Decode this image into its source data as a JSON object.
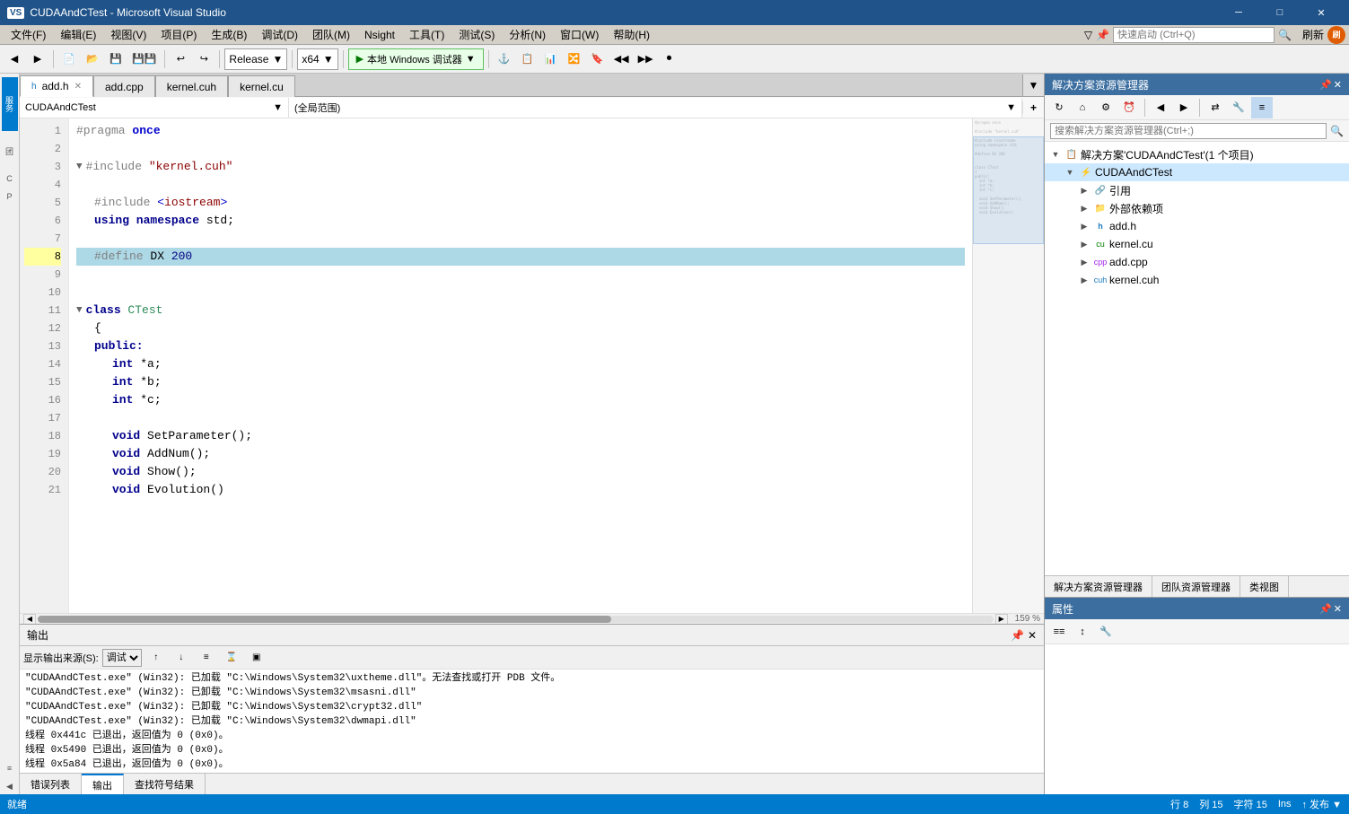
{
  "titleBar": {
    "appName": "CUDAAndCTest - Microsoft Visual Studio",
    "logo": "VS",
    "controls": {
      "minimize": "─",
      "maximize": "□",
      "close": "✕"
    }
  },
  "menuBar": {
    "items": [
      "文件(F)",
      "编辑(E)",
      "视图(V)",
      "项目(P)",
      "生成(B)",
      "调试(D)",
      "团队(M)",
      "Nsight",
      "工具(T)",
      "测试(S)",
      "分析(N)",
      "窗口(W)",
      "帮助(H)"
    ]
  },
  "toolbar": {
    "configuration": "Release",
    "platform": "x64",
    "debugBtn": "▶ 本地 Windows 调试器 ▼",
    "quickLaunch": {
      "placeholder": "快速启动 (Ctrl+Q)"
    }
  },
  "userInfo": {
    "name": "刷新"
  },
  "tabs": [
    {
      "name": "add.h",
      "active": true,
      "modified": false
    },
    {
      "name": "add.cpp",
      "active": false
    },
    {
      "name": "kernel.cuh",
      "active": false
    },
    {
      "name": "kernel.cu",
      "active": false
    }
  ],
  "codeBar": {
    "className": "CUDAAndCTest",
    "memberName": "(全局范围)"
  },
  "code": {
    "lines": [
      {
        "num": 1,
        "indicator": "green",
        "text": "#pragma once",
        "type": "pragma"
      },
      {
        "num": 2,
        "indicator": "green",
        "text": "",
        "type": "empty"
      },
      {
        "num": 3,
        "indicator": "none",
        "text": "▼#include \"kernel.cuh\"",
        "type": "include"
      },
      {
        "num": 4,
        "indicator": "green",
        "text": "",
        "type": "empty"
      },
      {
        "num": 5,
        "indicator": "green",
        "text": "\t#include <iostream>",
        "type": "include2"
      },
      {
        "num": 6,
        "indicator": "green",
        "text": "\tusing namespace std;",
        "type": "using"
      },
      {
        "num": 7,
        "indicator": "green",
        "text": "",
        "type": "empty"
      },
      {
        "num": 8,
        "indicator": "green",
        "text": "\t#define DX 200",
        "type": "define"
      },
      {
        "num": 9,
        "indicator": "green",
        "text": "",
        "type": "empty"
      },
      {
        "num": 10,
        "indicator": "green",
        "text": "",
        "type": "empty"
      },
      {
        "num": 11,
        "indicator": "none",
        "text": "▼class CTest",
        "type": "class"
      },
      {
        "num": 12,
        "indicator": "none",
        "text": "\t{",
        "type": "brace"
      },
      {
        "num": 13,
        "indicator": "none",
        "text": "\tpublic:",
        "type": "access"
      },
      {
        "num": 14,
        "indicator": "none",
        "text": "\t\tint *a;",
        "type": "member"
      },
      {
        "num": 15,
        "indicator": "none",
        "text": "\t\tint *b;",
        "type": "member"
      },
      {
        "num": 16,
        "indicator": "none",
        "text": "\t\tint *c;",
        "type": "member"
      },
      {
        "num": 17,
        "indicator": "none",
        "text": "",
        "type": "empty"
      },
      {
        "num": 18,
        "indicator": "none",
        "text": "\t\tvoid SetParameter();",
        "type": "method"
      },
      {
        "num": 19,
        "indicator": "none",
        "text": "\t\tvoid AddNum();",
        "type": "method"
      },
      {
        "num": 20,
        "indicator": "none",
        "text": "\t\tvoid Show();",
        "type": "method"
      },
      {
        "num": 21,
        "indicator": "none",
        "text": "\t\tvoid Evolution()",
        "type": "method_partial"
      }
    ]
  },
  "solutionExplorer": {
    "header": "解决方案资源管理器",
    "searchPlaceholder": "搜索解决方案资源管理器(Ctrl+;)",
    "tree": [
      {
        "level": 0,
        "expander": "▼",
        "icon": "📋",
        "label": "解决方案'CUDAAndCTest'(1 个项目)",
        "type": "solution"
      },
      {
        "level": 1,
        "expander": "▼",
        "icon": "⚡",
        "label": "CUDAAndCTest",
        "type": "project",
        "selected": true
      },
      {
        "level": 2,
        "expander": "▶",
        "icon": "🔗",
        "label": "引用",
        "type": "folder"
      },
      {
        "level": 2,
        "expander": "▶",
        "icon": "📁",
        "label": "外部依赖项",
        "type": "folder"
      },
      {
        "level": 2,
        "expander": "▶",
        "icon": "📄",
        "label": "add.h",
        "type": "file"
      },
      {
        "level": 2,
        "expander": "▶",
        "icon": "📄",
        "label": "kernel.cu",
        "type": "file"
      },
      {
        "level": 2,
        "expander": "▶",
        "icon": "📄",
        "label": "add.cpp",
        "type": "file"
      },
      {
        "level": 2,
        "expander": "▶",
        "icon": "📄",
        "label": "kernel.cuh",
        "type": "file"
      }
    ],
    "bottomTabs": [
      "解决方案资源管理器",
      "团队资源管理器",
      "类视图"
    ]
  },
  "properties": {
    "header": "属性",
    "content": ""
  },
  "output": {
    "header": "输出",
    "sourceLabel": "显示输出来源(S):",
    "sourceValue": "调试",
    "lines": [
      "\"CUDAAndCTest.exe\" (Win32): 已加载 \"C:\\Windows\\System32\\uxtheme.dll\"。无法查找或打开 PDB 文件。",
      "\"CUDAAndCTest.exe\" (Win32): 已卸载 \"C:\\Windows\\System32\\msasni.dll\"",
      "\"CUDAAndCTest.exe\" (Win32): 已卸载 \"C:\\Windows\\System32\\crypt32.dll\"",
      "\"CUDAAndCTest.exe\" (Win32): 已加载 \"C:\\Windows\\System32\\dwmapi.dll\"",
      "线程 0x441c 已退出，返回值为 0 (0x0)。",
      "线程 0x5490 已退出，返回值为 0 (0x0)。",
      "线程 0x5a84 已退出，返回值为 0 (0x0)。"
    ],
    "tabs": [
      "错误列表",
      "输出",
      "查找符号结果"
    ],
    "activeTab": "输出"
  },
  "statusBar": {
    "status": "就绪",
    "row": "行 8",
    "col": "列 15",
    "char": "字符 15",
    "mode": "Ins",
    "branch": "↑ 发布 ▼",
    "zoom": "159 %"
  }
}
